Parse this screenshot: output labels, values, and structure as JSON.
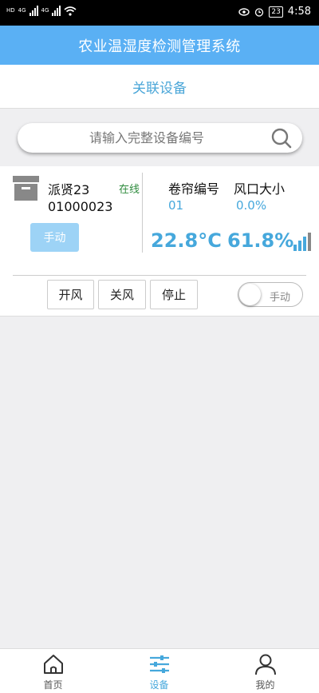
{
  "status_bar": {
    "left_badges": [
      "HD",
      "4G",
      "4G"
    ],
    "battery": "23",
    "time": "4:58"
  },
  "header": {
    "title": "农业温湿度检测管理系统"
  },
  "subheader": {
    "title": "关联设备"
  },
  "search": {
    "placeholder": "请输入完整设备编号",
    "value": ""
  },
  "device": {
    "name": "派贤23",
    "id": "01000023",
    "status": "在线",
    "mode_button": "手动",
    "curtain_label": "卷帘编号",
    "curtain_value": "01",
    "vent_label": "风口大小",
    "vent_value": "0.0%",
    "temperature": "22.8°C",
    "humidity": "61.8%",
    "signal_level": 4,
    "signal_max": 4,
    "controls": [
      "开风",
      "关风",
      "停止"
    ],
    "toggle_label": "手动",
    "toggle_on": false
  },
  "bottom_nav": {
    "items": [
      {
        "label": "首页",
        "icon": "home-icon",
        "active": false
      },
      {
        "label": "设备",
        "icon": "sliders-icon",
        "active": true
      },
      {
        "label": "我的",
        "icon": "user-icon",
        "active": false
      }
    ]
  },
  "colors": {
    "header": "#5ab0f4",
    "accent": "#46a8dc",
    "online": "#2e8b3d",
    "mode_button": "#9dd3f6"
  }
}
